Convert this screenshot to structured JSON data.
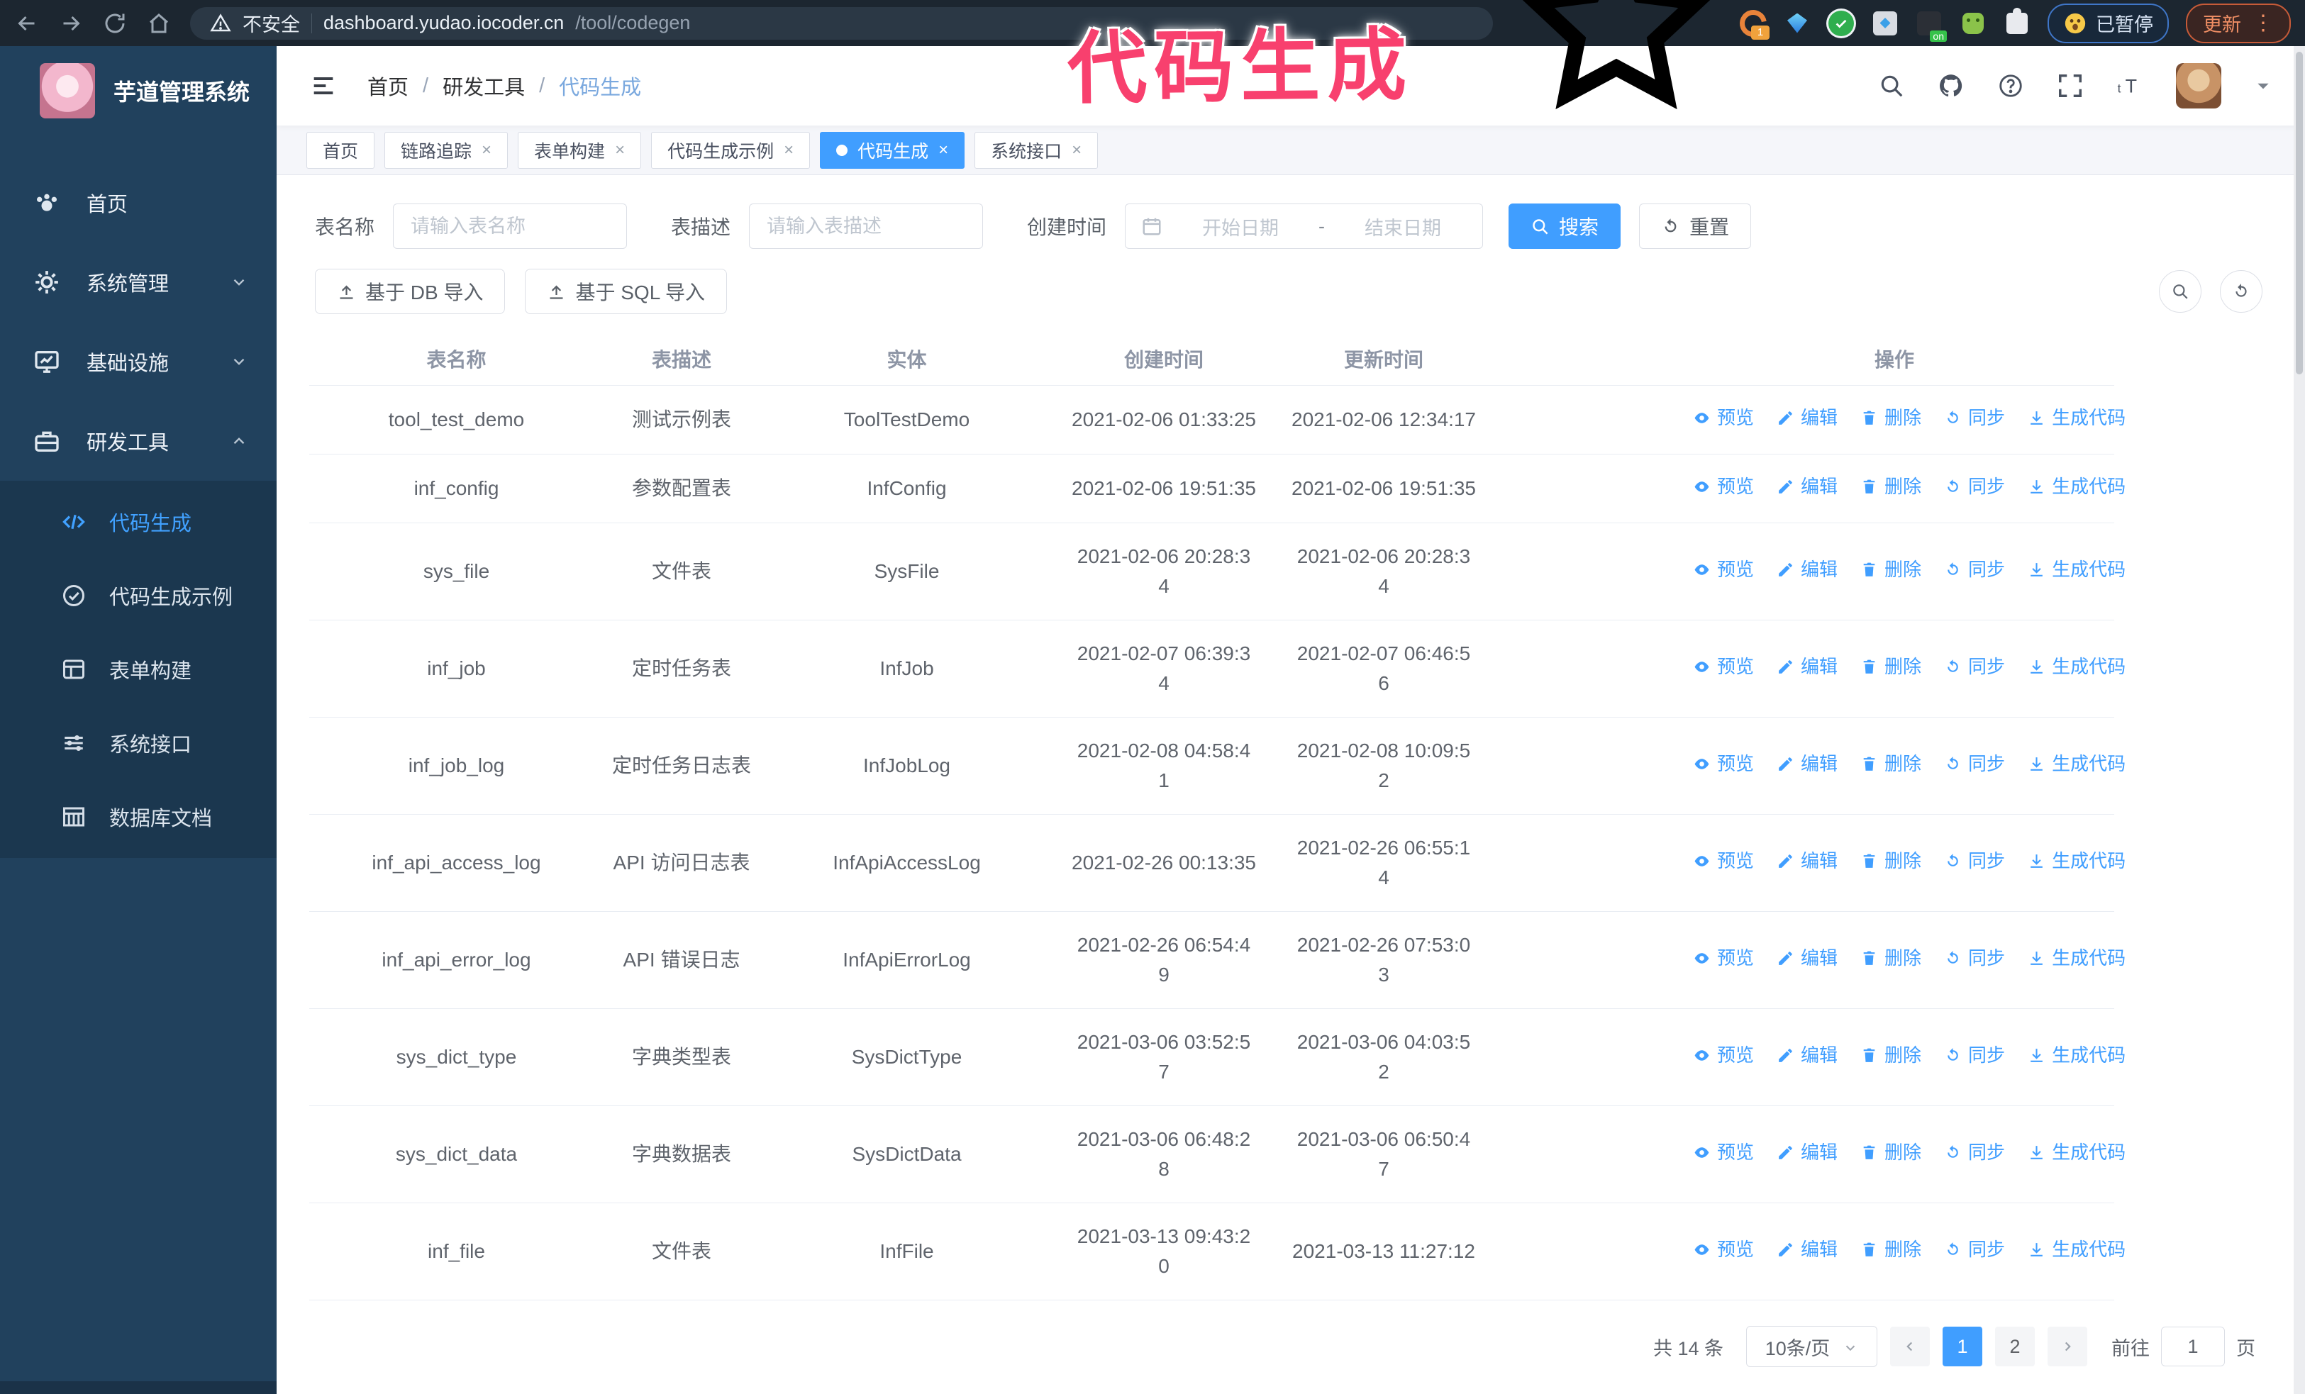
{
  "browser": {
    "security_label": "不安全",
    "url_host": "dashboard.yudao.iocoder.cn",
    "url_path": "/tool/codegen",
    "extension_badge": "1",
    "extension_on_badge": "on",
    "paused_label": "已暂停",
    "update_label": "更新",
    "update_dots": "⋮"
  },
  "annotation": {
    "text": "代码生成",
    "color": "#f8406e"
  },
  "sidebar": {
    "app_title": "芋道管理系统",
    "items": [
      {
        "label": "首页"
      },
      {
        "label": "系统管理"
      },
      {
        "label": "基础设施"
      },
      {
        "label": "研发工具"
      }
    ],
    "submenu": [
      {
        "label": "代码生成"
      },
      {
        "label": "代码生成示例"
      },
      {
        "label": "表单构建"
      },
      {
        "label": "系统接口"
      },
      {
        "label": "数据库文档"
      }
    ]
  },
  "header": {
    "breadcrumb": [
      "首页",
      "研发工具",
      "代码生成"
    ],
    "separator": "/"
  },
  "tabs": [
    {
      "label": "首页"
    },
    {
      "label": "链路追踪"
    },
    {
      "label": "表单构建"
    },
    {
      "label": "代码生成示例"
    },
    {
      "label": "代码生成"
    },
    {
      "label": "系统接口"
    }
  ],
  "filters": {
    "name_label": "表名称",
    "name_placeholder": "请输入表名称",
    "desc_label": "表描述",
    "desc_placeholder": "请输入表描述",
    "time_label": "创建时间",
    "start_placeholder": "开始日期",
    "range_separator": "-",
    "end_placeholder": "结束日期",
    "search_label": "搜索",
    "reset_label": "重置"
  },
  "toolbar": {
    "import_db_label": "基于 DB 导入",
    "import_sql_label": "基于 SQL 导入"
  },
  "table": {
    "headers": [
      "表名称",
      "表描述",
      "实体",
      "创建时间",
      "更新时间",
      "操作"
    ],
    "actions": [
      "预览",
      "编辑",
      "删除",
      "同步",
      "生成代码"
    ],
    "rows": [
      {
        "name": "tool_test_demo",
        "desc": "测试示例表",
        "entity": "ToolTestDemo",
        "create_time": "2021-02-06 01:33:25",
        "update_time": "2021-02-06 12:34:17"
      },
      {
        "name": "inf_config",
        "desc": "参数配置表",
        "entity": "InfConfig",
        "create_time": "2021-02-06 19:51:35",
        "update_time": "2021-02-06 19:51:35"
      },
      {
        "name": "sys_file",
        "desc": "文件表",
        "entity": "SysFile",
        "create_time": "2021-02-06 20:28:3\n4",
        "update_time": "2021-02-06 20:28:3\n4"
      },
      {
        "name": "inf_job",
        "desc": "定时任务表",
        "entity": "InfJob",
        "create_time": "2021-02-07 06:39:3\n4",
        "update_time": "2021-02-07 06:46:5\n6"
      },
      {
        "name": "inf_job_log",
        "desc": "定时任务日志表",
        "entity": "InfJobLog",
        "create_time": "2021-02-08 04:58:4\n1",
        "update_time": "2021-02-08 10:09:5\n2"
      },
      {
        "name": "inf_api_access_log",
        "desc": "API 访问日志表",
        "entity": "InfApiAccessLog",
        "create_time": "2021-02-26 00:13:35",
        "update_time": "2021-02-26 06:55:1\n4"
      },
      {
        "name": "inf_api_error_log",
        "desc": "API 错误日志",
        "entity": "InfApiErrorLog",
        "create_time": "2021-02-26 06:54:4\n9",
        "update_time": "2021-02-26 07:53:0\n3"
      },
      {
        "name": "sys_dict_type",
        "desc": "字典类型表",
        "entity": "SysDictType",
        "create_time": "2021-03-06 03:52:5\n7",
        "update_time": "2021-03-06 04:03:5\n2"
      },
      {
        "name": "sys_dict_data",
        "desc": "字典数据表",
        "entity": "SysDictData",
        "create_time": "2021-03-06 06:48:2\n8",
        "update_time": "2021-03-06 06:50:4\n7"
      },
      {
        "name": "inf_file",
        "desc": "文件表",
        "entity": "InfFile",
        "create_time": "2021-03-13 09:43:2\n0",
        "update_time": "2021-03-13 11:27:12"
      }
    ]
  },
  "pagination": {
    "total": "共 14 条",
    "page_size": "10条/页",
    "pages": [
      "1",
      "2"
    ],
    "active_page": "1",
    "goto_label": "前往",
    "goto_value": "1",
    "page_unit": "页"
  }
}
